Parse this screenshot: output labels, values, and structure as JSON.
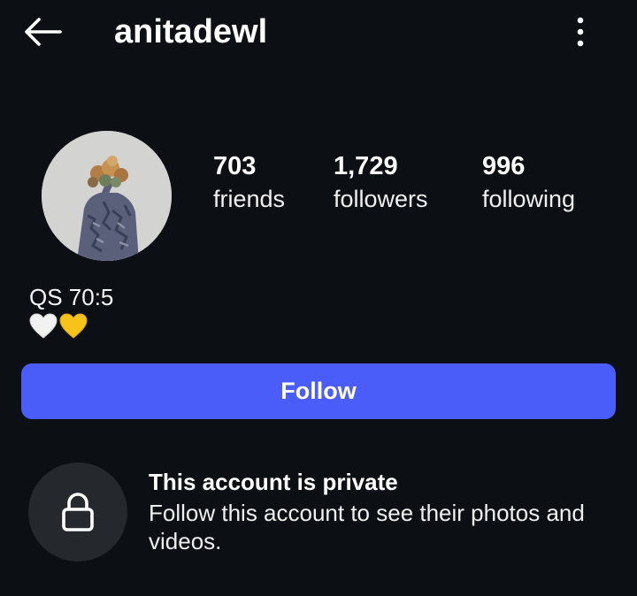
{
  "header": {
    "username": "anitadewl",
    "back_icon": "arrow-left-icon",
    "more_icon": "more-vertical-icon"
  },
  "profile": {
    "avatar": "profile-photo",
    "stats": [
      {
        "value": "703",
        "label": "friends"
      },
      {
        "value": "1,729",
        "label": "followers"
      },
      {
        "value": "996",
        "label": "following"
      }
    ],
    "bio_line": "QS 70:5",
    "bio_emoji": [
      "white-heart",
      "yellow-heart"
    ]
  },
  "follow_button": {
    "label": "Follow",
    "color": "#4a5df9"
  },
  "private_notice": {
    "icon": "lock-icon",
    "title": "This account is private",
    "description": "Follow this account to see their photos and videos."
  },
  "colors": {
    "background": "#0c1014",
    "lock_circle": "#25292e"
  }
}
